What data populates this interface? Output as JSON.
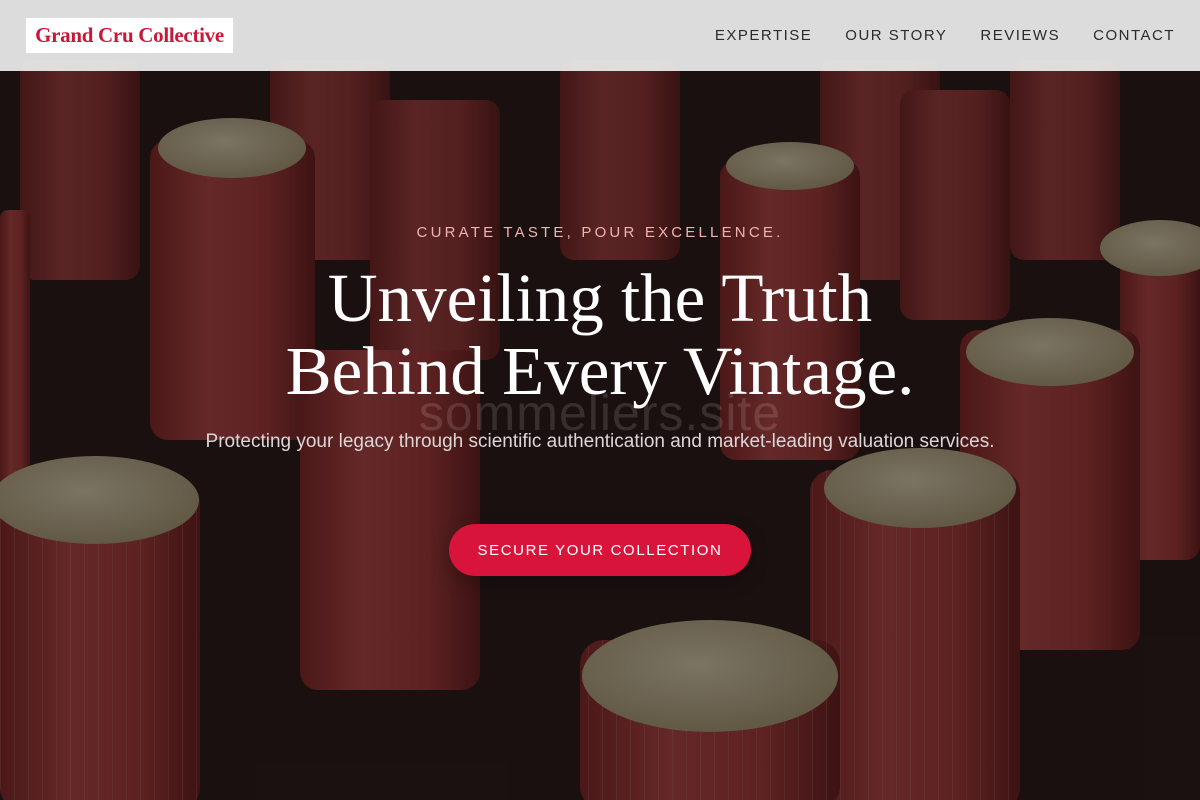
{
  "header": {
    "logo_text": "Grand Cru Collective",
    "nav": [
      {
        "label": "EXPERTISE"
      },
      {
        "label": "OUR STORY"
      },
      {
        "label": "REVIEWS"
      },
      {
        "label": "CONTACT"
      }
    ]
  },
  "hero": {
    "eyebrow": "CURATE TASTE, POUR EXCELLENCE.",
    "headline_line1": "Unveiling the Truth",
    "headline_line2": "Behind Every Vintage.",
    "watermark": "sommeliers.site",
    "subtext": "Protecting your legacy through scientific authentication and market-leading valuation services.",
    "cta_label": "SECURE YOUR COLLECTION",
    "background_image": "wine-bottle-caps-photo"
  },
  "colors": {
    "brand": "#c8183a",
    "cta": "#d8143a",
    "header_bg": "#ececec",
    "eyebrow": "#f0b3b3",
    "capsule_red": "#b83a3a"
  }
}
